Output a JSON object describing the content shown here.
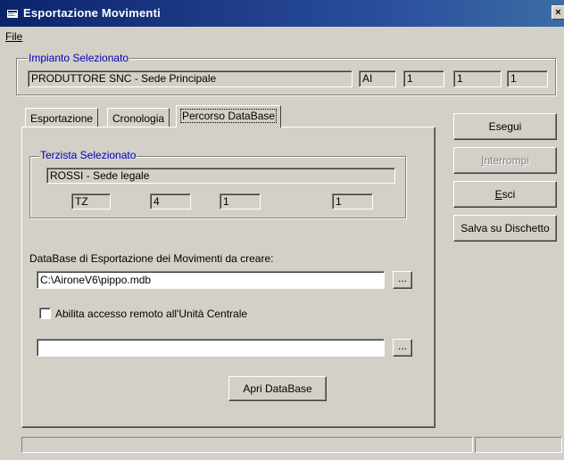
{
  "window": {
    "title": "Esportazione Movimenti",
    "close_glyph": "×",
    "icon": "app-icon"
  },
  "menu": {
    "file_label": "File"
  },
  "impianto": {
    "group_label": "Impianto Selezionato",
    "name": "PRODUTTORE SNC  -  Sede Principale",
    "code": "AI",
    "field2": "1",
    "field3": "1",
    "field4": "1"
  },
  "tabs": [
    {
      "label": "Esportazione"
    },
    {
      "label": "Cronologia"
    },
    {
      "label": "Percorso DataBase"
    }
  ],
  "terzista": {
    "group_label": "Terzista Selezionato",
    "name": "ROSSI  -  Sede legale",
    "code": "TZ",
    "field2": "4",
    "field3": "1",
    "field4": "1"
  },
  "database": {
    "label": "DataBase di Esportazione dei Movimenti da creare:",
    "path": "C:\\AironeV6\\pippo.mdb",
    "browse_label": "...",
    "remote_checkbox_label": "Abilita accesso remoto all'Unità Centrale",
    "remote_checked": false,
    "remote_path": "",
    "remote_browse_label": "...",
    "open_button": "Apri DataBase"
  },
  "actions": {
    "esegui": "Esegui",
    "interrompi": "Interrompi",
    "esci": "Esci",
    "salva": "Salva su Dischetto"
  },
  "colors": {
    "face": "#d4d0c8",
    "title_bar": "#0a246a",
    "group_label": "#0000c0"
  }
}
